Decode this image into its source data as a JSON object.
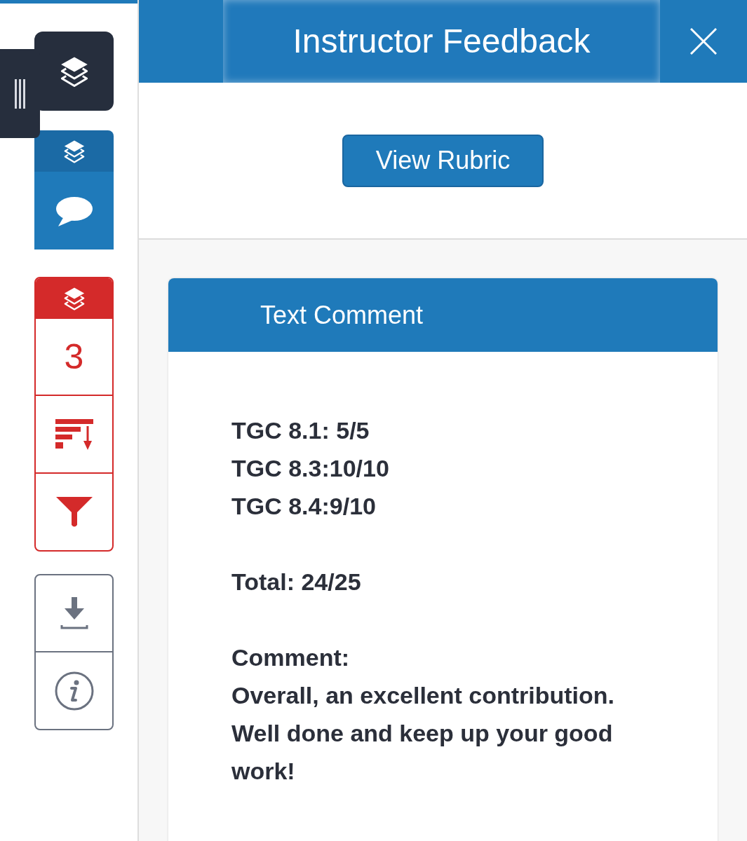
{
  "sidebar": {
    "issue_count": "3"
  },
  "panel": {
    "title": "Instructor Feedback",
    "rubric_button": "View Rubric",
    "comment_card": {
      "title": "Text Comment",
      "paragraphs": [
        [
          "TGC 8.1: 5/5",
          "TGC 8.3:10/10",
          "TGC 8.4:9/10"
        ],
        [
          "Total: 24/25"
        ],
        [
          "Comment:",
          "Overall, an excellent contribution.",
          "Well done and keep up your good work!"
        ]
      ]
    }
  }
}
